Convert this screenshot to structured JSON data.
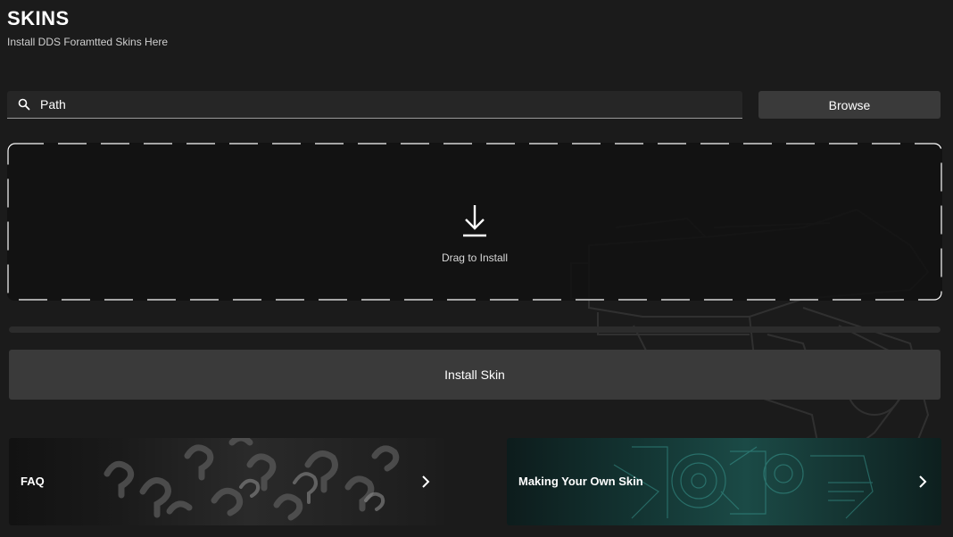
{
  "header": {
    "title": "SKINS",
    "subtitle": "Install DDS Foramtted Skins Here"
  },
  "path_input": {
    "placeholder": "Path",
    "value": "",
    "icon": "search-icon"
  },
  "browse_button": {
    "label": "Browse"
  },
  "drop_zone": {
    "label": "Drag to Install",
    "icon": "download-icon"
  },
  "progress": {
    "value": 0
  },
  "install_button": {
    "label": "Install Skin"
  },
  "cards": [
    {
      "label": "FAQ",
      "icon": "chevron-right-icon"
    },
    {
      "label": "Making Your Own Skin",
      "icon": "chevron-right-icon"
    }
  ],
  "colors": {
    "background": "#1b1b1b",
    "button": "#3a3a3a",
    "text": "#ffffff",
    "skin_card_accent": "#1b4a46"
  }
}
